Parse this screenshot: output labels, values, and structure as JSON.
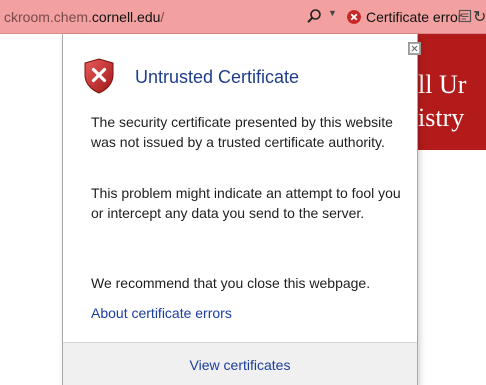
{
  "address_bar": {
    "url_prefix": "ckroom.chem.",
    "url_domain": "cornell.edu",
    "url_suffix": "/",
    "cert_error_label": "Certificate error"
  },
  "background_page": {
    "heading_line1": "ll Ur",
    "heading_line2": "istry",
    "accent_color": "#b31b1b"
  },
  "popup": {
    "title": "Untrusted Certificate",
    "paragraph1": "The security certificate presented by this website was not issued by a trusted certificate authority.",
    "paragraph2": "This problem might indicate an attempt to fool you or intercept any data you send to the server.",
    "paragraph3": "We recommend that you close this webpage.",
    "about_link": "About certificate errors",
    "view_certificates": "View certificates"
  },
  "icons": [
    "search-icon",
    "chevron-down-icon",
    "cert-error-icon",
    "compat-view-icon",
    "refresh-icon",
    "close-icon",
    "shield-error-icon"
  ]
}
